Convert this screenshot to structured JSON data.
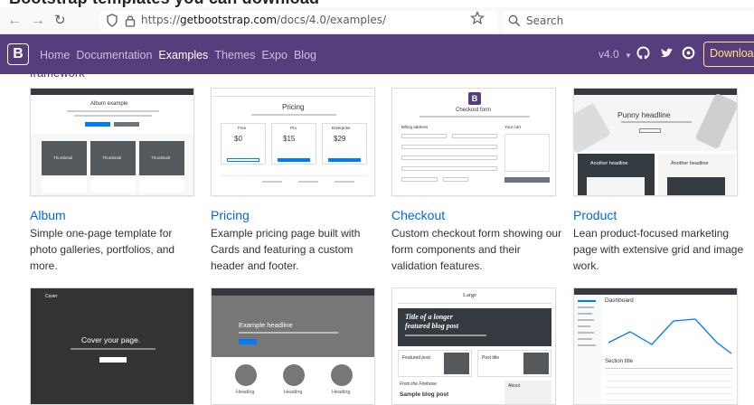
{
  "caption": "Bootstrap templates you can download",
  "browser": {
    "url_prefix": "https://",
    "url_domain": "getbootstrap.com",
    "url_path": "/docs/4.0/examples/",
    "search_placeholder": "Search"
  },
  "navbar": {
    "brand": "B",
    "links": [
      "Home",
      "Documentation",
      "Examples",
      "Themes",
      "Expo",
      "Blog"
    ],
    "active": "Examples",
    "version": "v4.0",
    "download": "Download",
    "brand_color": "#563d7c",
    "download_color": "#ffe484"
  },
  "partial_text": "framework",
  "examples": [
    {
      "title": "Album",
      "description": "Simple one-page template for photo galleries, portfolios, and more.",
      "thumb": {
        "heading": "Album example",
        "cards": [
          "Thumbnail",
          "Thumbnail",
          "Thumbnail"
        ]
      }
    },
    {
      "title": "Pricing",
      "description": "Example pricing page built with Cards and featuring a custom header and footer.",
      "thumb": {
        "heading": "Pricing",
        "plans": [
          "Free",
          "Pro",
          "Enterprise"
        ],
        "prices": [
          "$0",
          "$15",
          "$29"
        ]
      }
    },
    {
      "title": "Checkout",
      "description": "Custom checkout form showing our form components and their validation features.",
      "thumb": {
        "heading": "Checkout form",
        "section": "Billing address",
        "cart": "Your cart"
      }
    },
    {
      "title": "Product",
      "description": "Lean product-focused marketing page with extensive grid and image work.",
      "thumb": {
        "headline": "Punny headline",
        "sub1": "Another headline",
        "sub2": "Another headline"
      }
    }
  ],
  "bottom_row": [
    {
      "heading": "Cover your page.",
      "brand": "Cover"
    },
    {
      "heading": "Example headline",
      "items": [
        "Heading",
        "Heading",
        "Heading"
      ]
    },
    {
      "brand": "Large",
      "headline_line1": "Title of a longer",
      "headline_line2": "featured blog post",
      "post1": "Featured post",
      "post2": "Post title",
      "footer_title": "From the Firehose",
      "sample": "Sample blog post",
      "about": "About"
    },
    {
      "heading": "Dashboard",
      "section": "Section title"
    }
  ]
}
